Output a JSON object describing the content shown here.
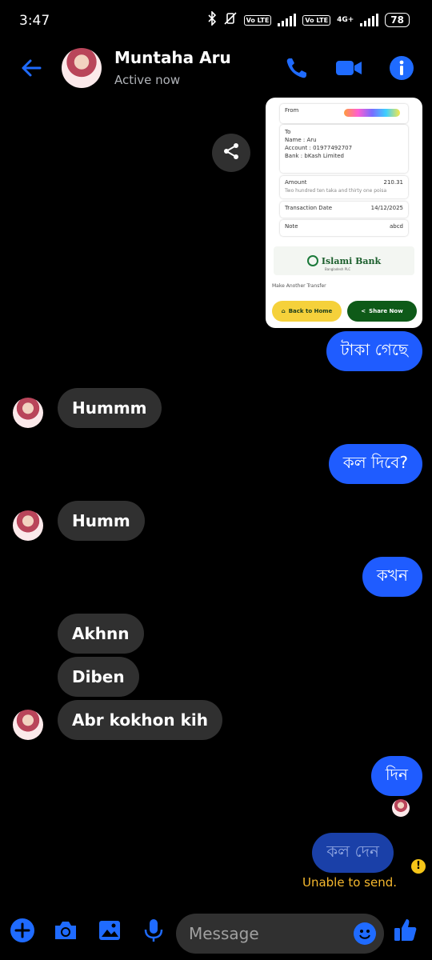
{
  "status_bar": {
    "time": "3:47",
    "sim1_tag": "Vo LTE",
    "sim2_tag": "Vo LTE",
    "network": "4G+",
    "battery": "78"
  },
  "header": {
    "contact_name": "Muntaha Aru",
    "presence": "Active now",
    "icons": [
      "back-arrow-icon",
      "phone-icon",
      "video-camera-icon",
      "info-icon"
    ],
    "accent_color": "#1f6bff"
  },
  "receipt": {
    "from_label": "From",
    "to_label": "To",
    "name_line": "Name   : Aru",
    "account_line": "Account : 01977492707",
    "bank_line": "Bank   : bKash Limited",
    "amount_label": "Amount",
    "amount_value": "210.31",
    "amount_words": "Two hundred ten taka and thirty one poisa",
    "date_label": "Transaction Date",
    "date_value": "14/12/2025",
    "note_label": "Note",
    "note_value": "abcd",
    "bank_name": "Islami Bank",
    "bank_subtitle": "Bangladesh PLC",
    "make_another": "Make Another Transfer",
    "back_home": "Back to Home",
    "share_now": "Share Now"
  },
  "messages": [
    {
      "side": "out",
      "text": "টাকা গেছে"
    },
    {
      "side": "in",
      "text": "Hummm"
    },
    {
      "side": "out",
      "text": "কল দিবে?"
    },
    {
      "side": "in",
      "text": "Humm"
    },
    {
      "side": "out",
      "text": "কখন"
    },
    {
      "side": "in",
      "text": "Akhnn"
    },
    {
      "side": "in",
      "text": "Diben"
    },
    {
      "side": "in",
      "text": "Abr kokhon kih"
    },
    {
      "side": "out",
      "text": "দিন"
    },
    {
      "side": "out",
      "text": "কল দেন",
      "status": "failed"
    }
  ],
  "failure": {
    "badge": "!",
    "text": "Unable to send."
  },
  "composer": {
    "placeholder": "Message",
    "icons": [
      "plus-icon",
      "camera-icon",
      "gallery-icon",
      "microphone-icon",
      "emoji-icon",
      "thumbs-up-icon"
    ]
  }
}
